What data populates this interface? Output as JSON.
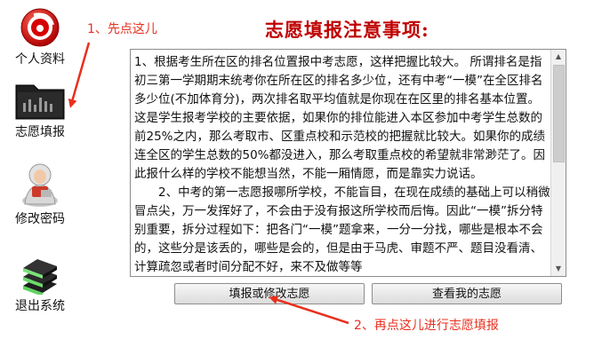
{
  "title": "志愿填报注意事项:",
  "sidebar": {
    "items": [
      {
        "label": "个人资料",
        "icon": "logo-badge-icon"
      },
      {
        "label": "志愿填报",
        "icon": "folder-icon"
      },
      {
        "label": "修改密码",
        "icon": "user-avatar-icon"
      },
      {
        "label": "退出系统",
        "icon": "books-icon"
      }
    ]
  },
  "notice": {
    "paragraphs": [
      "1、根据考生所在区的排名位置报中考志愿，这样把握比较大。 所谓排名是指初三第一学期期末统考你在所在区的排名多少位，还有中考“一模”在全区排名多少位(不加体育分)，两次排名取平均值就是你现在在区里的排名基本位置。这是学生报考学校的主要依据，如果你的排位能进入本区参加中考学生总数的前25%之内，那么考取市、区重点校和示范校的把握就比较大。如果你的成绩连全区的学生总数的50%都没进入，那么考取重点校的希望就非常渺茫了。因此报什么样的学校不能想当然，不能一厢情愿，而是靠实力说话。",
      "2、中考的第一志愿报哪所学校，不能盲目，在现在成绩的基础上可以稍微冒点尖，万一发挥好了，不会由于没有报这所学校而后悔。因此“一模”拆分特别重要，拆分过程如下：把各门“一模”题拿来，一分一分找，哪些是根本不会的，这些分是该丢的，哪些是会的，但是由于马虎、审题不严、题目没看清、计算疏忽或者时间分配不好，来不及做等等"
    ]
  },
  "buttons": {
    "apply": "填报或修改志愿",
    "view": "查看我的志愿"
  },
  "annotations": {
    "first": "1、先点这儿",
    "second": "2、再点这儿进行志愿填报"
  },
  "colors": {
    "title": "#c00000",
    "annotation": "#e8301f"
  }
}
